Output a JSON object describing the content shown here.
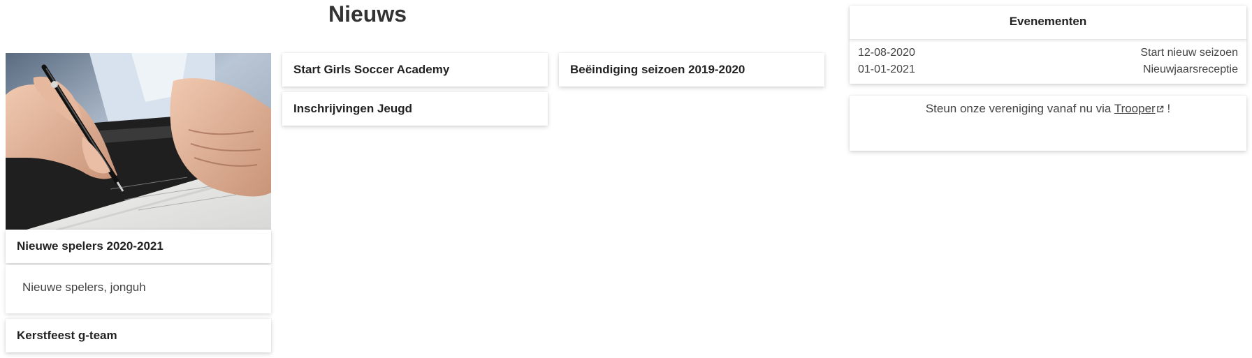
{
  "page": {
    "title": "Nieuws"
  },
  "news": {
    "featured": {
      "image_alt": "hand signing a document with a pen",
      "title": "Nieuwe spelers 2020-2021",
      "excerpt": "Nieuwe spelers, jonguh"
    },
    "items": [
      {
        "title": "Kerstfeest g-team"
      },
      {
        "title": "Start Girls Soccer Academy"
      },
      {
        "title": "Inschrijvingen Jeugd"
      },
      {
        "title": "Beëindiging seizoen 2019-2020"
      }
    ]
  },
  "events": {
    "header": "Evenementen",
    "rows": [
      {
        "date": "12-08-2020",
        "name": "Start nieuw seizoen"
      },
      {
        "date": "01-01-2021",
        "name": "Nieuwjaarsreceptie"
      }
    ]
  },
  "support": {
    "text_before": "Steun onze vereniging vanaf nu via ",
    "link_label": "Trooper",
    "text_after": " !",
    "link_icon": "external-link-icon"
  }
}
